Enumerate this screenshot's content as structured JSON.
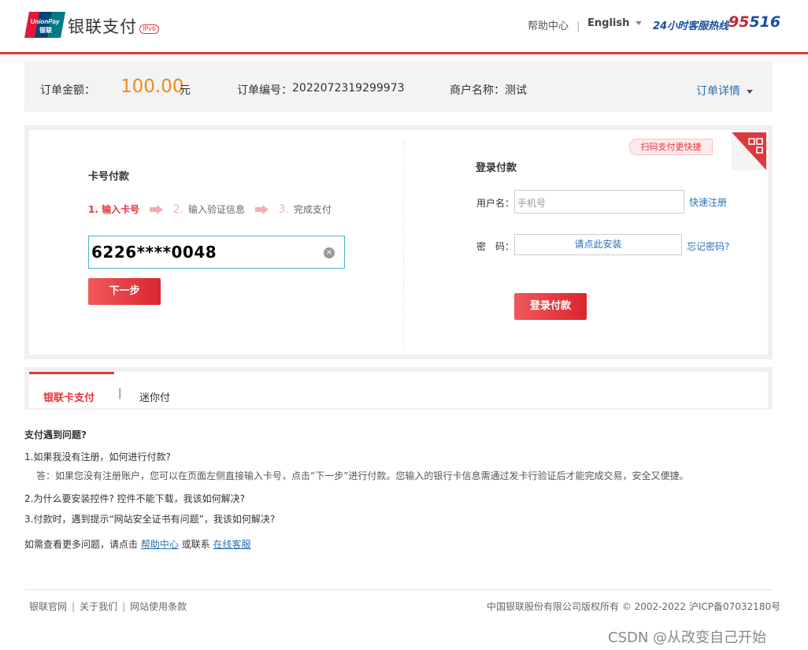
{
  "header": {
    "logo_text": "UnionPay 银联",
    "brand_title": "银联支付",
    "ipv6_badge": "IPv6",
    "help_center": "帮助中心",
    "nav_separator": "|",
    "language": "English",
    "hotline_label": "24小时客服热线",
    "hotline_number_a": "95",
    "hotline_number_b": "516"
  },
  "order": {
    "amount_label": "订单金额：",
    "amount_value": "100.00",
    "amount_unit": "元",
    "order_no_label": "订单编号：",
    "order_no_value": "2022072319299973",
    "merchant_label": "商户名称：",
    "merchant_value": "测试",
    "detail_link": "订单详情"
  },
  "card_pay": {
    "title": "卡号付款",
    "steps": [
      {
        "num": "1.",
        "label": "输入卡号"
      },
      {
        "num": "2.",
        "label": "输入验证信息"
      },
      {
        "num": "3.",
        "label": "完成支付"
      }
    ],
    "card_number_value": "6226****0048",
    "clear_glyph": "×",
    "next_button": "下一步"
  },
  "login_pay": {
    "title": "登录付款",
    "username_label": "用户名：",
    "username_placeholder": "手机号",
    "register_link": "快速注册",
    "password_label": "密　码：",
    "password_install_prompt": "请点此安装",
    "forgot_link": "忘记密码?",
    "login_button": "登录付款",
    "qr_tag": "扫码支付更快捷"
  },
  "tabs": [
    {
      "label": "银联卡支付"
    },
    {
      "label": "迷你付"
    }
  ],
  "tab_separator": "|",
  "faq": {
    "title": "支付遇到问题?",
    "q1": "1.如果我没有注册，如何进行付款?",
    "a1": "答：如果您没有注册账户，您可以在页面左侧直接输入卡号，点击“下一步”进行付款。您输入的银行卡信息需通过发卡行验证后才能完成交易，安全又便捷。",
    "q2": "2.为什么要安装控件? 控件不能下载，我该如何解决?",
    "q3": "3.付款时，遇到提示“网站安全证书有问题”，我该如何解决?",
    "more_prefix": "如需查看更多问题，请点击 ",
    "help_center_link": "帮助中心",
    "more_mid": " 或联系 ",
    "online_service_link": "在线客服"
  },
  "footer": {
    "links": [
      "银联官网",
      "关于我们",
      "网站使用条款"
    ],
    "separator": "|",
    "copyright": "中国银联股份有限公司版权所有 © 2002-2022  沪ICP备07032180号"
  },
  "watermark": "CSDN @从改变自己开始",
  "colors": {
    "accent_red": "#e0373f",
    "amount_orange": "#f08a1c",
    "link_blue": "#2d6fb3",
    "hotline_blue": "#1b4e9e"
  }
}
